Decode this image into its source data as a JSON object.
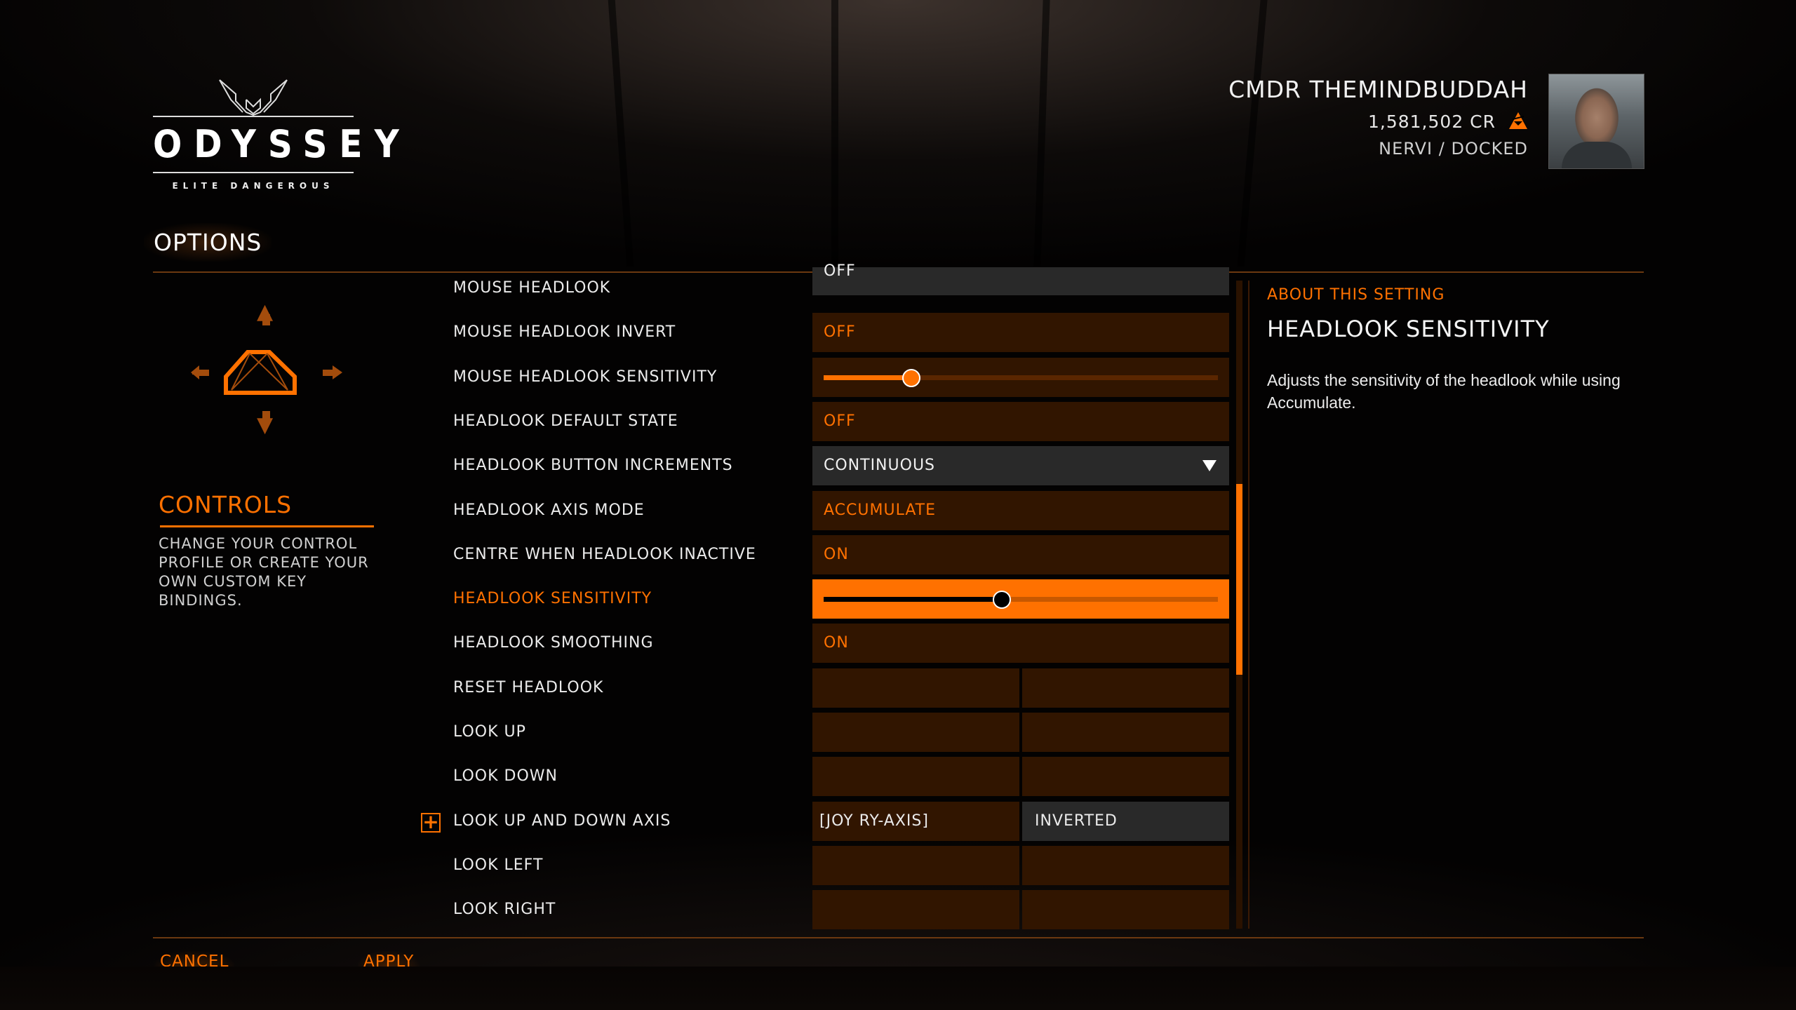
{
  "logo": {
    "word": "ODYSSEY",
    "subtitle": "ELITE DANGEROUS"
  },
  "commander": {
    "name": "CMDR THEMINDBUDDAH",
    "credits": "1,581,502 CR",
    "location": "NERVI / DOCKED",
    "rank_icon": "combat-rank-icon"
  },
  "page_title": "OPTIONS",
  "controls": {
    "title": "CONTROLS",
    "description": "CHANGE YOUR CONTROL PROFILE OR CREATE YOUR OWN CUSTOM KEY BINDINGS."
  },
  "settings": [
    {
      "label": "MOUSE HEADLOOK",
      "type": "toggle",
      "value": "OFF",
      "style": "grey"
    },
    {
      "label": "MOUSE HEADLOOK INVERT",
      "type": "toggle",
      "value": "OFF"
    },
    {
      "label": "MOUSE HEADLOOK SENSITIVITY",
      "type": "slider",
      "value_fraction": 0.22
    },
    {
      "label": "HEADLOOK DEFAULT STATE",
      "type": "toggle",
      "value": "OFF"
    },
    {
      "label": "HEADLOOK BUTTON INCREMENTS",
      "type": "dropdown",
      "value": "CONTINUOUS"
    },
    {
      "label": "HEADLOOK AXIS MODE",
      "type": "toggle",
      "value": "ACCUMULATE"
    },
    {
      "label": "CENTRE WHEN HEADLOOK INACTIVE",
      "type": "toggle",
      "value": "ON"
    },
    {
      "label": "HEADLOOK SENSITIVITY",
      "type": "slider",
      "value_fraction": 0.45,
      "selected": true
    },
    {
      "label": "HEADLOOK SMOOTHING",
      "type": "toggle",
      "value": "ON"
    },
    {
      "label": "RESET HEADLOOK",
      "type": "binding",
      "primary": "",
      "secondary": ""
    },
    {
      "label": "LOOK UP",
      "type": "binding",
      "primary": "",
      "secondary": ""
    },
    {
      "label": "LOOK DOWN",
      "type": "binding",
      "primary": "",
      "secondary": ""
    },
    {
      "label": "LOOK UP AND DOWN AXIS",
      "type": "axis",
      "primary": "[JOY RY-AXIS]",
      "secondary": "INVERTED",
      "expandable": true
    },
    {
      "label": "LOOK LEFT",
      "type": "binding",
      "primary": "",
      "secondary": ""
    },
    {
      "label": "LOOK RIGHT",
      "type": "binding",
      "primary": "",
      "secondary": ""
    }
  ],
  "scroll": {
    "thumb_start_fraction": 0.31,
    "thumb_size_fraction": 0.29
  },
  "about": {
    "kicker": "ABOUT THIS SETTING",
    "title": "HEADLOOK SENSITIVITY",
    "description": "Adjusts the sensitivity of the headlook while using Accumulate."
  },
  "footer": {
    "cancel": "CANCEL",
    "apply": "APPLY"
  },
  "colors": {
    "accent": "#ff7100",
    "row_bg": "#311500",
    "row_grey": "#292929"
  }
}
